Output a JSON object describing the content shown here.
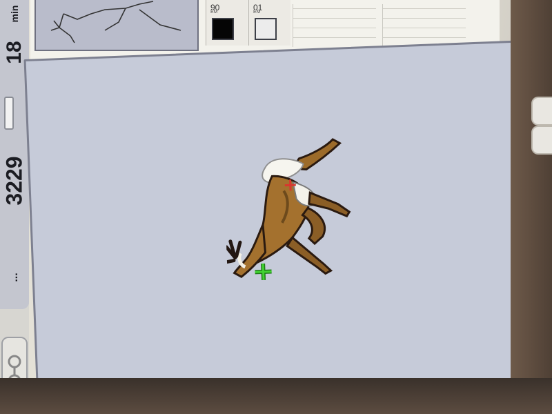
{
  "status": {
    "time_value": "18",
    "time_unit": "min",
    "stitch_count": "3229",
    "ellipsis": "..."
  },
  "colors": [
    {
      "code": "90",
      "label": "EM",
      "hex": "#050505"
    },
    {
      "code": "01",
      "label": "EM",
      "hex": "#ececec"
    }
  ],
  "design": {
    "thumbnail": "deer-outline-thumbnail",
    "main": "deer-embroidery-design",
    "center_marker_color": "#d8372f",
    "start_marker_color": "#41d132"
  },
  "ui_colors": {
    "canvas": "#c6cbd9",
    "panel": "#f3f2ec",
    "bezel": "#5a4a3f"
  }
}
